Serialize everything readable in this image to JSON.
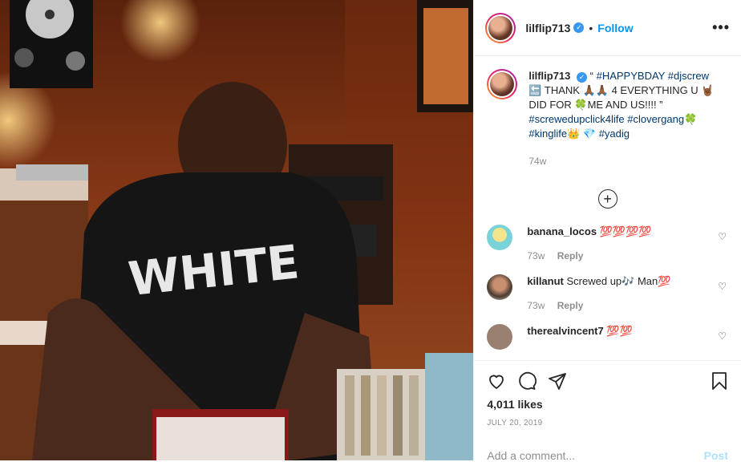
{
  "header": {
    "username": "lilflip713",
    "follow_label": "Follow",
    "dot": "•"
  },
  "caption": {
    "username": "lilflip713",
    "text_1": "“ ",
    "tag_1": "#HAPPYBDAY",
    "tag_2": "#djscrew",
    "text_2": "🔚 THANK 🙏🏾🙏🏾 4 EVERYTHING U 🤘🏾 DID FOR 🍀ME AND US!!!! ”",
    "tag_3": "#screwedupclick4life",
    "tag_4": "#clovergang",
    "text_3": "🍀",
    "tag_5": "#kinglife",
    "text_4": "👑 💎",
    "tag_6": "#yadig",
    "time": "74w"
  },
  "comments": [
    {
      "username": "banana_locos",
      "text": "💯💯💯💯",
      "time": "73w",
      "reply": "Reply",
      "avatar_color": "#7ad3d8"
    },
    {
      "username": "killanut",
      "text": "Screwed up🎶 Man💯",
      "time": "73w",
      "reply": "Reply",
      "avatar_color": "#8a5a44"
    },
    {
      "username": "therealvincent7",
      "text": "💯💯",
      "time": "",
      "reply": "",
      "avatar_color": "#9a8070"
    }
  ],
  "actions": {
    "likes": "4,011 likes",
    "date": "JULY 20, 2019"
  },
  "add_comment": {
    "placeholder": "Add a comment...",
    "post_label": "Post"
  },
  "colors": {
    "link": "#0095f6",
    "hashtag": "#00376b",
    "muted": "#8e8e8e"
  }
}
